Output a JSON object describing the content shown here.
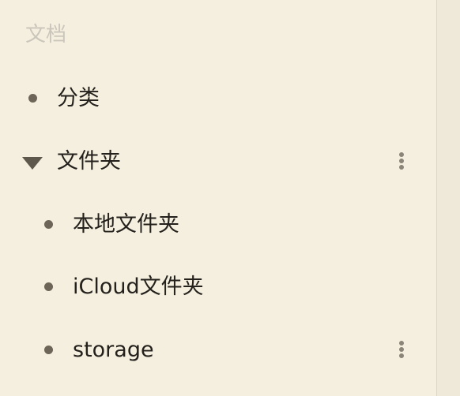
{
  "sidebar": {
    "section_title": "文档",
    "items": [
      {
        "label": "分类"
      },
      {
        "label": "文件夹",
        "expanded": true,
        "children": [
          {
            "label": "本地文件夹"
          },
          {
            "label": "iCloud文件夹"
          },
          {
            "label": "storage"
          }
        ]
      }
    ],
    "icons": {
      "bullet": "bullet-dot-icon",
      "expand": "triangle-down-icon",
      "more": "more-vertical-icon"
    }
  },
  "colors": {
    "background": "#f5efdf",
    "text": "#24211c",
    "muted": "#cbc6bb",
    "bullet": "#6d6558"
  }
}
